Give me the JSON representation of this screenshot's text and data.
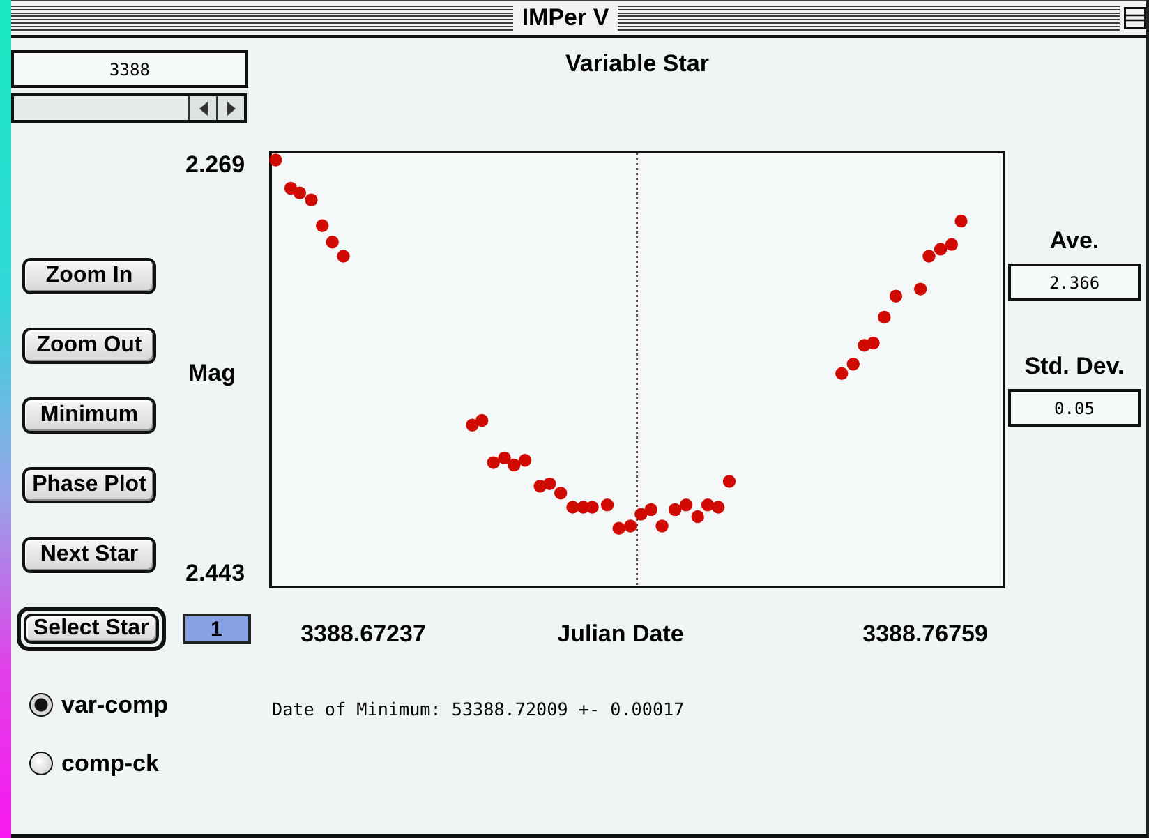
{
  "window": {
    "title": "IMPer V"
  },
  "date_field": {
    "value": "3388"
  },
  "chart": {
    "chart_data": {
      "type": "scatter",
      "title": "Variable Star",
      "xlabel": "Julian Date",
      "ylabel": "Mag",
      "x": [
        3388.65753,
        3388.66008,
        3388.66161,
        3388.66356,
        3388.66543,
        3388.66713,
        3388.669,
        3388.69085,
        3388.69247,
        3388.69442,
        3388.69629,
        3388.69791,
        3388.69978,
        3388.70233,
        3388.70395,
        3388.70582,
        3388.70786,
        3388.70964,
        3388.71117,
        3388.71372,
        3388.71568,
        3388.71763,
        3388.71942,
        3388.72112,
        3388.72299,
        3388.7252,
        3388.72707,
        3388.72903,
        3388.73073,
        3388.73251,
        3388.73438,
        3388.75343,
        3388.75538,
        3388.75725,
        3388.75878,
        3388.76065,
        3388.76261,
        3388.76677,
        3388.76822,
        3388.77018,
        3388.77205,
        3388.77366
      ],
      "series": [
        {
          "color": "#d00a00",
          "values": [
            2.267,
            2.279,
            2.281,
            2.284,
            2.295,
            2.302,
            2.308,
            2.38,
            2.378,
            2.396,
            2.394,
            2.397,
            2.395,
            2.406,
            2.405,
            2.409,
            2.415,
            2.415,
            2.415,
            2.414,
            2.424,
            2.423,
            2.418,
            2.416,
            2.423,
            2.416,
            2.414,
            2.419,
            2.414,
            2.415,
            2.404,
            2.358,
            2.354,
            2.346,
            2.345,
            2.334,
            2.325,
            2.322,
            2.308,
            2.305,
            2.303,
            2.293
          ]
        }
      ],
      "xlim": [
        3388.65642,
        3388.78116
      ],
      "ylim": [
        2.44962,
        2.26298
      ],
      "xticks": [
        {
          "value": 3388.67237,
          "label": "3388.67237"
        },
        {
          "value": 3388.76759,
          "label": "3388.76759"
        }
      ],
      "yticks": [
        {
          "value": 2.269,
          "label": "2.269"
        },
        {
          "value": 2.443,
          "label": "2.443"
        }
      ],
      "ref_lines": [
        {
          "axis": "x",
          "value": 3388.71874
        }
      ]
    }
  },
  "buttons": [
    "Zoom In",
    "Zoom Out",
    "Minimum",
    "Phase Plot",
    "Next Star"
  ],
  "statistics": [
    {
      "label": "Ave.",
      "value": "2.366"
    },
    {
      "label": "Std. Dev.",
      "value": "0.05"
    }
  ],
  "star_selector": {
    "button": {
      "label": "Select Star",
      "default": true
    },
    "field": {
      "value": "1",
      "highlighted": true
    }
  },
  "radio_options": [
    {
      "label": "var-comp",
      "selected": true
    },
    {
      "label": "comp-ck",
      "selected": false
    }
  ],
  "result": "Date of Minimum: 53388.72009 +- 0.00017"
}
